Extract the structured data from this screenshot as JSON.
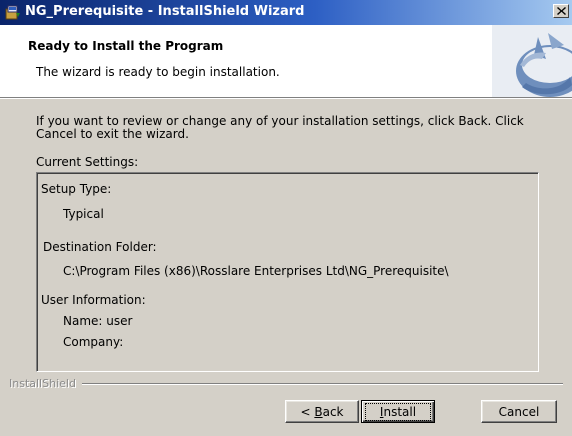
{
  "window": {
    "title": "NG_Prerequisite - InstallShield Wizard"
  },
  "header": {
    "title": "Ready to Install the Program",
    "subtitle": "The wizard is ready to begin installation."
  },
  "main": {
    "intro": "If you want to review or change any of your installation settings, click Back. Click Cancel to exit the wizard.",
    "current_settings_label": "Current Settings:",
    "settings": {
      "setup_type_label": "Setup Type:",
      "setup_type_value": "Typical",
      "destination_label": "Destination Folder:",
      "destination_value": "C:\\Program Files (x86)\\Rosslare Enterprises Ltd\\NG_Prerequisite\\",
      "user_info_label": "User Information:",
      "name_line": "Name: user",
      "company_line": "Company:"
    }
  },
  "footer": {
    "brand": "InstallShield",
    "back_prefix": "< ",
    "back_mnemonic": "B",
    "back_rest": "ack",
    "install_mnemonic": "I",
    "install_rest": "nstall",
    "cancel_label": "Cancel"
  },
  "icons": {
    "app": "installer-icon",
    "close": "close-icon",
    "banner": "installshield-logo-icon"
  },
  "colors": {
    "titlebar_start": "#0a246a",
    "titlebar_end": "#a6caf0",
    "face": "#d4d0c8",
    "logo_blue": "#4a6fa5"
  }
}
